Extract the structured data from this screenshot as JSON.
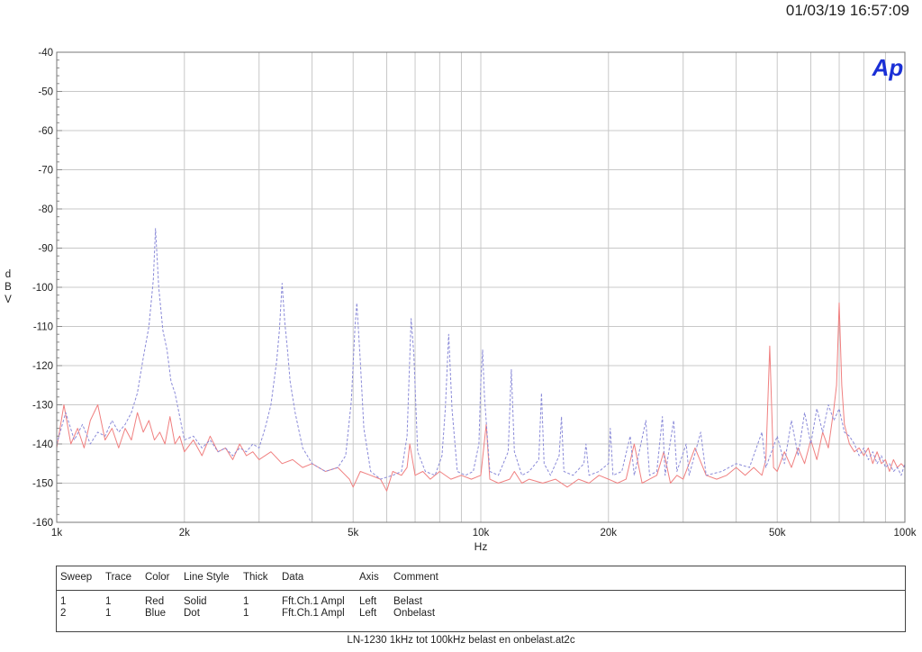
{
  "timestamp": "01/03/19 16:57:09",
  "logo_text": "Ap",
  "footer_text": "LN-1230 1kHz tot 100kHz belast en onbelast.at2c",
  "legend": {
    "headers": [
      "Sweep",
      "Trace",
      "Color",
      "Line Style",
      "Thick",
      "Data",
      "Axis",
      "Comment"
    ],
    "rows": [
      [
        "1",
        "1",
        "Red",
        "Solid",
        "1",
        "Fft.Ch.1 Ampl",
        "Left",
        "Belast"
      ],
      [
        "2",
        "1",
        "Blue",
        "Dot",
        "1",
        "Fft.Ch.1 Ampl",
        "Left",
        "Onbelast"
      ]
    ]
  },
  "chart_data": {
    "type": "line",
    "xlabel": "Hz",
    "ylabel": "dBV",
    "xscale": "log",
    "xlim": [
      1000,
      100000
    ],
    "ylim": [
      -160,
      -40
    ],
    "yticks": [
      -40,
      -50,
      -60,
      -70,
      -80,
      -90,
      -100,
      -110,
      -120,
      -130,
      -140,
      -150,
      -160
    ],
    "xticks": [
      {
        "value": 1000,
        "label": "1k"
      },
      {
        "value": 2000,
        "label": "2k"
      },
      {
        "value": 5000,
        "label": "5k"
      },
      {
        "value": 10000,
        "label": "10k"
      },
      {
        "value": 20000,
        "label": "20k"
      },
      {
        "value": 50000,
        "label": "50k"
      },
      {
        "value": 100000,
        "label": "100k"
      }
    ],
    "grid": true,
    "colors": {
      "Belast": "#f08080",
      "Onbelast": "#8a8ad8"
    },
    "series": [
      {
        "name": "Belast",
        "style": "solid",
        "points": [
          [
            1000,
            -141
          ],
          [
            1040,
            -130
          ],
          [
            1080,
            -140
          ],
          [
            1120,
            -136
          ],
          [
            1160,
            -141
          ],
          [
            1200,
            -134
          ],
          [
            1250,
            -130
          ],
          [
            1300,
            -139
          ],
          [
            1350,
            -136
          ],
          [
            1400,
            -141
          ],
          [
            1450,
            -136
          ],
          [
            1500,
            -139
          ],
          [
            1550,
            -132
          ],
          [
            1600,
            -137
          ],
          [
            1650,
            -134
          ],
          [
            1700,
            -139
          ],
          [
            1750,
            -137
          ],
          [
            1800,
            -140
          ],
          [
            1850,
            -133
          ],
          [
            1900,
            -140
          ],
          [
            1950,
            -138
          ],
          [
            2000,
            -142
          ],
          [
            2100,
            -139
          ],
          [
            2200,
            -143
          ],
          [
            2300,
            -138
          ],
          [
            2400,
            -142
          ],
          [
            2500,
            -141
          ],
          [
            2600,
            -144
          ],
          [
            2700,
            -140
          ],
          [
            2800,
            -143
          ],
          [
            2900,
            -142
          ],
          [
            3000,
            -144
          ],
          [
            3200,
            -142
          ],
          [
            3400,
            -145
          ],
          [
            3600,
            -144
          ],
          [
            3800,
            -146
          ],
          [
            4000,
            -145
          ],
          [
            4300,
            -147
          ],
          [
            4600,
            -146
          ],
          [
            4900,
            -149
          ],
          [
            5000,
            -151
          ],
          [
            5200,
            -147
          ],
          [
            5500,
            -148
          ],
          [
            5800,
            -149
          ],
          [
            6000,
            -152
          ],
          [
            6200,
            -147
          ],
          [
            6500,
            -148
          ],
          [
            6700,
            -146
          ],
          [
            6800,
            -140
          ],
          [
            7000,
            -148
          ],
          [
            7300,
            -147
          ],
          [
            7600,
            -149
          ],
          [
            8000,
            -147
          ],
          [
            8500,
            -149
          ],
          [
            9000,
            -148
          ],
          [
            9500,
            -149
          ],
          [
            10000,
            -148
          ],
          [
            10300,
            -135
          ],
          [
            10500,
            -149
          ],
          [
            11000,
            -150
          ],
          [
            11700,
            -149
          ],
          [
            12000,
            -147
          ],
          [
            12500,
            -150
          ],
          [
            13000,
            -149
          ],
          [
            14000,
            -150
          ],
          [
            15000,
            -149
          ],
          [
            16000,
            -151
          ],
          [
            17000,
            -149
          ],
          [
            18000,
            -150
          ],
          [
            19000,
            -148
          ],
          [
            20000,
            -149
          ],
          [
            21000,
            -150
          ],
          [
            22000,
            -149
          ],
          [
            23000,
            -140
          ],
          [
            24000,
            -150
          ],
          [
            25000,
            -149
          ],
          [
            26000,
            -148
          ],
          [
            27000,
            -142
          ],
          [
            28000,
            -150
          ],
          [
            29000,
            -148
          ],
          [
            30000,
            -149
          ],
          [
            32000,
            -141
          ],
          [
            34000,
            -148
          ],
          [
            36000,
            -149
          ],
          [
            38000,
            -148
          ],
          [
            40000,
            -146
          ],
          [
            42000,
            -148
          ],
          [
            44000,
            -146
          ],
          [
            46000,
            -148
          ],
          [
            47000,
            -144
          ],
          [
            48000,
            -115
          ],
          [
            49000,
            -146
          ],
          [
            50000,
            -147
          ],
          [
            52000,
            -142
          ],
          [
            54000,
            -146
          ],
          [
            56000,
            -141
          ],
          [
            58000,
            -145
          ],
          [
            60000,
            -139
          ],
          [
            62000,
            -144
          ],
          [
            64000,
            -137
          ],
          [
            66000,
            -141
          ],
          [
            68000,
            -131
          ],
          [
            69000,
            -125
          ],
          [
            70000,
            -104
          ],
          [
            71000,
            -125
          ],
          [
            72000,
            -135
          ],
          [
            74000,
            -140
          ],
          [
            76000,
            -142
          ],
          [
            78000,
            -141
          ],
          [
            80000,
            -143
          ],
          [
            82000,
            -141
          ],
          [
            84000,
            -145
          ],
          [
            86000,
            -142
          ],
          [
            88000,
            -145
          ],
          [
            90000,
            -144
          ],
          [
            92000,
            -147
          ],
          [
            94000,
            -144
          ],
          [
            96000,
            -146
          ],
          [
            98000,
            -145
          ],
          [
            100000,
            -146
          ]
        ]
      },
      {
        "name": "Onbelast",
        "style": "dot",
        "points": [
          [
            1000,
            -140
          ],
          [
            1050,
            -132
          ],
          [
            1100,
            -139
          ],
          [
            1150,
            -135
          ],
          [
            1200,
            -140
          ],
          [
            1250,
            -137
          ],
          [
            1300,
            -138
          ],
          [
            1350,
            -134
          ],
          [
            1400,
            -137
          ],
          [
            1450,
            -135
          ],
          [
            1500,
            -132
          ],
          [
            1550,
            -127
          ],
          [
            1600,
            -118
          ],
          [
            1650,
            -110
          ],
          [
            1690,
            -98
          ],
          [
            1710,
            -85
          ],
          [
            1740,
            -100
          ],
          [
            1780,
            -111
          ],
          [
            1820,
            -116
          ],
          [
            1860,
            -124
          ],
          [
            1900,
            -127
          ],
          [
            1950,
            -133
          ],
          [
            2000,
            -139
          ],
          [
            2100,
            -138
          ],
          [
            2200,
            -141
          ],
          [
            2300,
            -139
          ],
          [
            2400,
            -142
          ],
          [
            2500,
            -141
          ],
          [
            2600,
            -143
          ],
          [
            2700,
            -141
          ],
          [
            2800,
            -142
          ],
          [
            2900,
            -140
          ],
          [
            3000,
            -141
          ],
          [
            3100,
            -136
          ],
          [
            3200,
            -130
          ],
          [
            3300,
            -119
          ],
          [
            3350,
            -111
          ],
          [
            3400,
            -99
          ],
          [
            3450,
            -109
          ],
          [
            3500,
            -116
          ],
          [
            3550,
            -124
          ],
          [
            3650,
            -132
          ],
          [
            3800,
            -141
          ],
          [
            4000,
            -145
          ],
          [
            4300,
            -147
          ],
          [
            4600,
            -146
          ],
          [
            4800,
            -143
          ],
          [
            4950,
            -129
          ],
          [
            5050,
            -110
          ],
          [
            5100,
            -104
          ],
          [
            5200,
            -119
          ],
          [
            5300,
            -136
          ],
          [
            5500,
            -147
          ],
          [
            5800,
            -149
          ],
          [
            6200,
            -148
          ],
          [
            6500,
            -147
          ],
          [
            6700,
            -138
          ],
          [
            6850,
            -108
          ],
          [
            6950,
            -117
          ],
          [
            7100,
            -142
          ],
          [
            7400,
            -147
          ],
          [
            7800,
            -148
          ],
          [
            8100,
            -143
          ],
          [
            8250,
            -131
          ],
          [
            8400,
            -112
          ],
          [
            8550,
            -131
          ],
          [
            8800,
            -147
          ],
          [
            9200,
            -148
          ],
          [
            9600,
            -147
          ],
          [
            9900,
            -140
          ],
          [
            10000,
            -124
          ],
          [
            10100,
            -116
          ],
          [
            10200,
            -128
          ],
          [
            10500,
            -147
          ],
          [
            11000,
            -148
          ],
          [
            11600,
            -142
          ],
          [
            11800,
            -121
          ],
          [
            12000,
            -142
          ],
          [
            12500,
            -148
          ],
          [
            13000,
            -147
          ],
          [
            13700,
            -144
          ],
          [
            13900,
            -127
          ],
          [
            14100,
            -145
          ],
          [
            14600,
            -148
          ],
          [
            15300,
            -143
          ],
          [
            15500,
            -133
          ],
          [
            15700,
            -147
          ],
          [
            16500,
            -148
          ],
          [
            17500,
            -145
          ],
          [
            17700,
            -140
          ],
          [
            18000,
            -148
          ],
          [
            19000,
            -147
          ],
          [
            20000,
            -145
          ],
          [
            20200,
            -136
          ],
          [
            20500,
            -148
          ],
          [
            21500,
            -147
          ],
          [
            22500,
            -138
          ],
          [
            23000,
            -148
          ],
          [
            24500,
            -134
          ],
          [
            25000,
            -148
          ],
          [
            26000,
            -147
          ],
          [
            26800,
            -133
          ],
          [
            27200,
            -148
          ],
          [
            28500,
            -134
          ],
          [
            29000,
            -147
          ],
          [
            30500,
            -140
          ],
          [
            31000,
            -148
          ],
          [
            33000,
            -137
          ],
          [
            34000,
            -148
          ],
          [
            37000,
            -147
          ],
          [
            40000,
            -145
          ],
          [
            43000,
            -146
          ],
          [
            46000,
            -137
          ],
          [
            47000,
            -146
          ],
          [
            50000,
            -138
          ],
          [
            52000,
            -145
          ],
          [
            54000,
            -134
          ],
          [
            56000,
            -143
          ],
          [
            58000,
            -132
          ],
          [
            60000,
            -140
          ],
          [
            62000,
            -131
          ],
          [
            64000,
            -137
          ],
          [
            66000,
            -130
          ],
          [
            68000,
            -134
          ],
          [
            70000,
            -131
          ],
          [
            72000,
            -137
          ],
          [
            74000,
            -138
          ],
          [
            76000,
            -140
          ],
          [
            78000,
            -143
          ],
          [
            80000,
            -141
          ],
          [
            82000,
            -144
          ],
          [
            84000,
            -142
          ],
          [
            86000,
            -145
          ],
          [
            88000,
            -143
          ],
          [
            90000,
            -146
          ],
          [
            92000,
            -145
          ],
          [
            94000,
            -147
          ],
          [
            96000,
            -146
          ],
          [
            98000,
            -148
          ],
          [
            100000,
            -145
          ]
        ]
      }
    ]
  }
}
